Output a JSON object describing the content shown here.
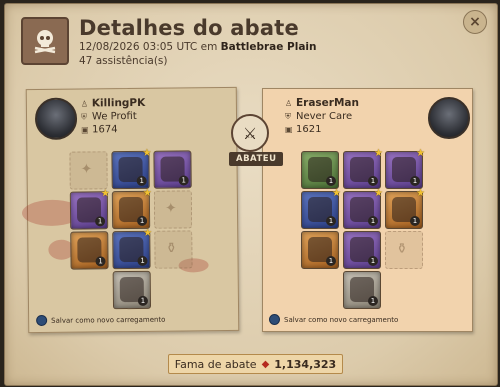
{
  "dialog": {
    "title": "Detalhes do abate",
    "datetime": "12/08/2026 03:05 UTC em",
    "location": "Battlebrae Plain",
    "assists": "47 assistência(s)",
    "close_icon": "×"
  },
  "killer": {
    "name": "KillingPK",
    "guild": "We Profit",
    "item_power": "1674",
    "save_loadout": "Salvar como novo carregamento",
    "equipment": [
      {
        "slot": "bag",
        "empty": true
      },
      {
        "slot": "head",
        "tier_color": "blue",
        "qty": "1",
        "star": true
      },
      {
        "slot": "cape",
        "tier_color": "purple",
        "qty": "1"
      },
      {
        "slot": "main-hand",
        "tier_color": "purple",
        "qty": "1",
        "star": true
      },
      {
        "slot": "armor",
        "tier_color": "orange",
        "qty": "1",
        "star": true
      },
      {
        "slot": "off-hand",
        "empty": true
      },
      {
        "slot": "food",
        "tier_color": "orange",
        "qty": "1"
      },
      {
        "slot": "shoes",
        "tier_color": "blue",
        "qty": "1",
        "star": true
      },
      {
        "slot": "potion",
        "empty": true
      },
      {
        "slot": "mount",
        "tier_color": "white",
        "qty": "1"
      }
    ]
  },
  "victim": {
    "name": "EraserMan",
    "guild": "Never Care",
    "item_power": "1621",
    "save_loadout": "Salvar como novo carregamento",
    "equipment": [
      {
        "slot": "bag",
        "tier_color": "green",
        "qty": "1"
      },
      {
        "slot": "head",
        "tier_color": "purple",
        "qty": "1",
        "star": true
      },
      {
        "slot": "cape",
        "tier_color": "purple",
        "qty": "1",
        "star": true
      },
      {
        "slot": "main-hand",
        "tier_color": "blue",
        "qty": "1",
        "star": true
      },
      {
        "slot": "armor",
        "tier_color": "purple",
        "qty": "1",
        "star": true
      },
      {
        "slot": "off-hand",
        "tier_color": "orange",
        "qty": "1",
        "star": true
      },
      {
        "slot": "food",
        "tier_color": "orange",
        "qty": "1"
      },
      {
        "slot": "shoes",
        "tier_color": "purple",
        "qty": "1"
      },
      {
        "slot": "potion",
        "empty": true
      },
      {
        "slot": "mount",
        "tier_color": "white",
        "qty": "1"
      }
    ]
  },
  "killed_label": "ABATEU",
  "fame": {
    "label": "Fama de abate",
    "value": "1,134,323"
  },
  "colors": {
    "parchment": "#e9dcc3",
    "victim_panel": "#f2d3ad",
    "tier_blue": "#3e57a8",
    "tier_purple": "#7a55aa",
    "tier_orange": "#c77b32"
  }
}
